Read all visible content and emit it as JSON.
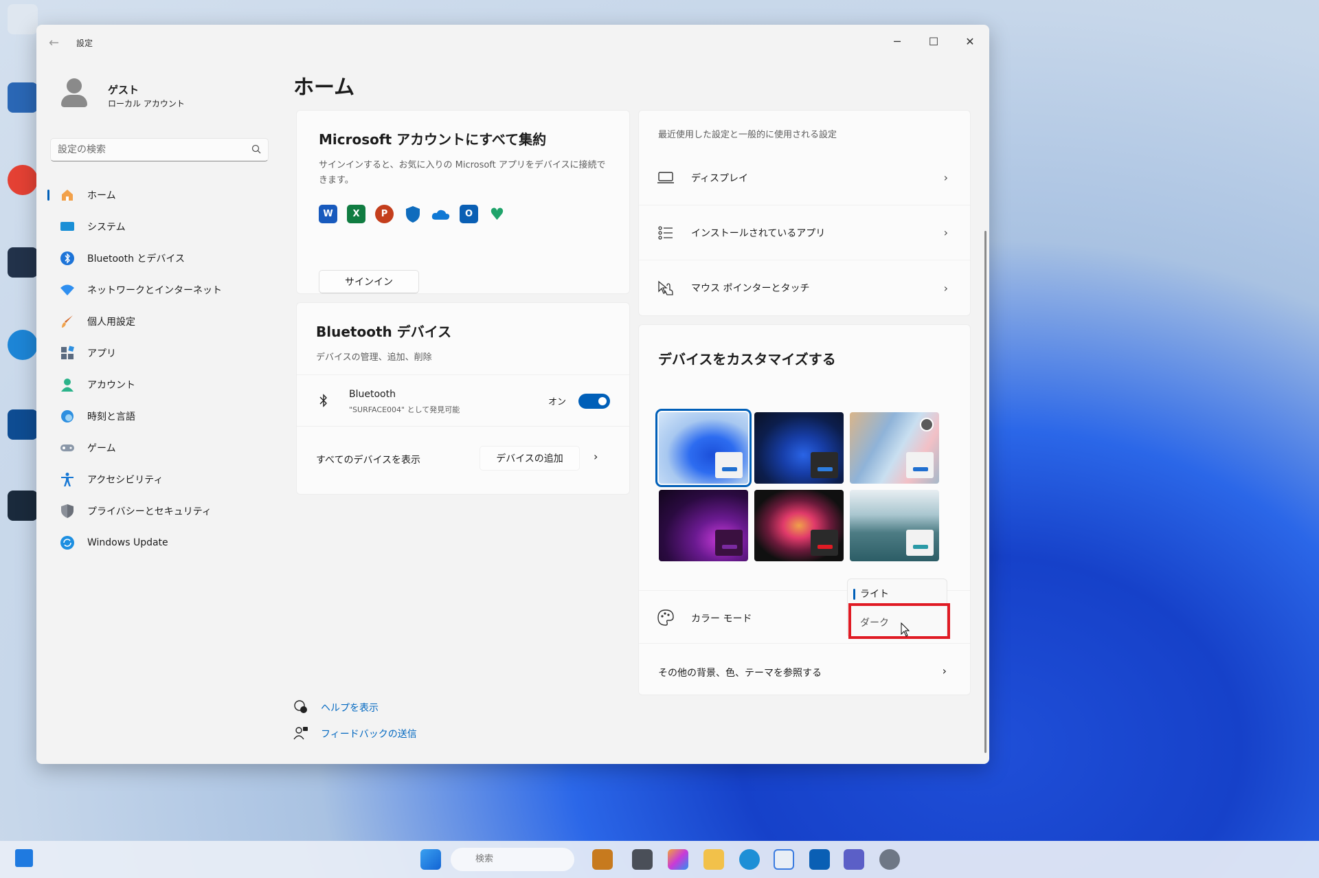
{
  "window": {
    "title": "設定",
    "back_icon": "back-arrow-icon"
  },
  "window_controls": {
    "minimize": "─",
    "maximize": "☐",
    "close": "✕"
  },
  "profile": {
    "name": "ゲスト",
    "subtitle": "ローカル アカウント"
  },
  "search": {
    "placeholder": "設定の検索"
  },
  "sidebar": {
    "items": [
      {
        "label": "ホーム",
        "icon": "home-icon",
        "active": true
      },
      {
        "label": "システム",
        "icon": "system-icon"
      },
      {
        "label": "Bluetooth とデバイス",
        "icon": "bluetooth-icon"
      },
      {
        "label": "ネットワークとインターネット",
        "icon": "wifi-icon"
      },
      {
        "label": "個人用設定",
        "icon": "brush-icon"
      },
      {
        "label": "アプリ",
        "icon": "apps-icon"
      },
      {
        "label": "アカウント",
        "icon": "account-icon"
      },
      {
        "label": "時刻と言語",
        "icon": "globe-clock-icon"
      },
      {
        "label": "ゲーム",
        "icon": "gamepad-icon"
      },
      {
        "label": "アクセシビリティ",
        "icon": "accessibility-icon"
      },
      {
        "label": "プライバシーとセキュリティ",
        "icon": "shield-icon"
      },
      {
        "label": "Windows Update",
        "icon": "update-icon"
      }
    ]
  },
  "main": {
    "title": "ホーム",
    "ms_account_card": {
      "title": "Microsoft アカウントにすべて集約",
      "description_line1": "サインインすると、お気に入りの Microsoft アプリをデバイスに接続で",
      "description_line2": "きます。",
      "apps": [
        {
          "name": "word-icon",
          "glyph": "W",
          "color": "#185abd"
        },
        {
          "name": "excel-icon",
          "glyph": "X",
          "color": "#107c41"
        },
        {
          "name": "powerpoint-icon",
          "glyph": "P",
          "color": "#c43e1c"
        },
        {
          "name": "defender-icon",
          "glyph": "",
          "color": "#0f6cbd"
        },
        {
          "name": "onedrive-icon",
          "glyph": "",
          "color": "#0f78d4"
        },
        {
          "name": "outlook-icon",
          "glyph": "O",
          "color": "#0a5fb4"
        },
        {
          "name": "family-icon",
          "glyph": "♥",
          "color": "#1fa36a"
        }
      ],
      "signin_button": "サインイン"
    },
    "bluetooth_card": {
      "title": "Bluetooth デバイス",
      "subtitle": "デバイスの管理、追加、削除",
      "device_label": "Bluetooth",
      "device_sub": "\"SURFACE004\" として発見可能",
      "toggle_label": "オン",
      "toggle_on": true,
      "show_all": "すべてのデバイスを表示",
      "add_button": "デバイスの追加"
    },
    "recent_card": {
      "header": "最近使用した設定と一般的に使用される設定",
      "rows": [
        {
          "label": "ディスプレイ",
          "icon": "monitor-icon"
        },
        {
          "label": "インストールされているアプリ",
          "icon": "app-list-icon"
        },
        {
          "label": "マウス ポインターとタッチ",
          "icon": "mouse-pointer-icon"
        }
      ]
    },
    "customize_card": {
      "title": "デバイスをカスタマイズする",
      "themes": [
        {
          "name": "theme-windows-light",
          "selected": true
        },
        {
          "name": "theme-windows-dark"
        },
        {
          "name": "theme-glow"
        },
        {
          "name": "theme-captured-motion"
        },
        {
          "name": "theme-flow"
        },
        {
          "name": "theme-sunrise"
        }
      ],
      "color_mode_label": "カラー モード",
      "color_mode_options": [
        "ライト",
        "ダーク"
      ],
      "color_mode_selected": "ライト",
      "more_link": "その他の背景、色、テーマを参照する"
    },
    "footer_links": {
      "help": "ヘルプを表示",
      "feedback": "フィードバックの送信"
    }
  },
  "taskbar": {
    "search_placeholder": "検索"
  },
  "colors": {
    "accent": "#005fb8",
    "highlight": "#e01b24",
    "link": "#0067c0"
  }
}
